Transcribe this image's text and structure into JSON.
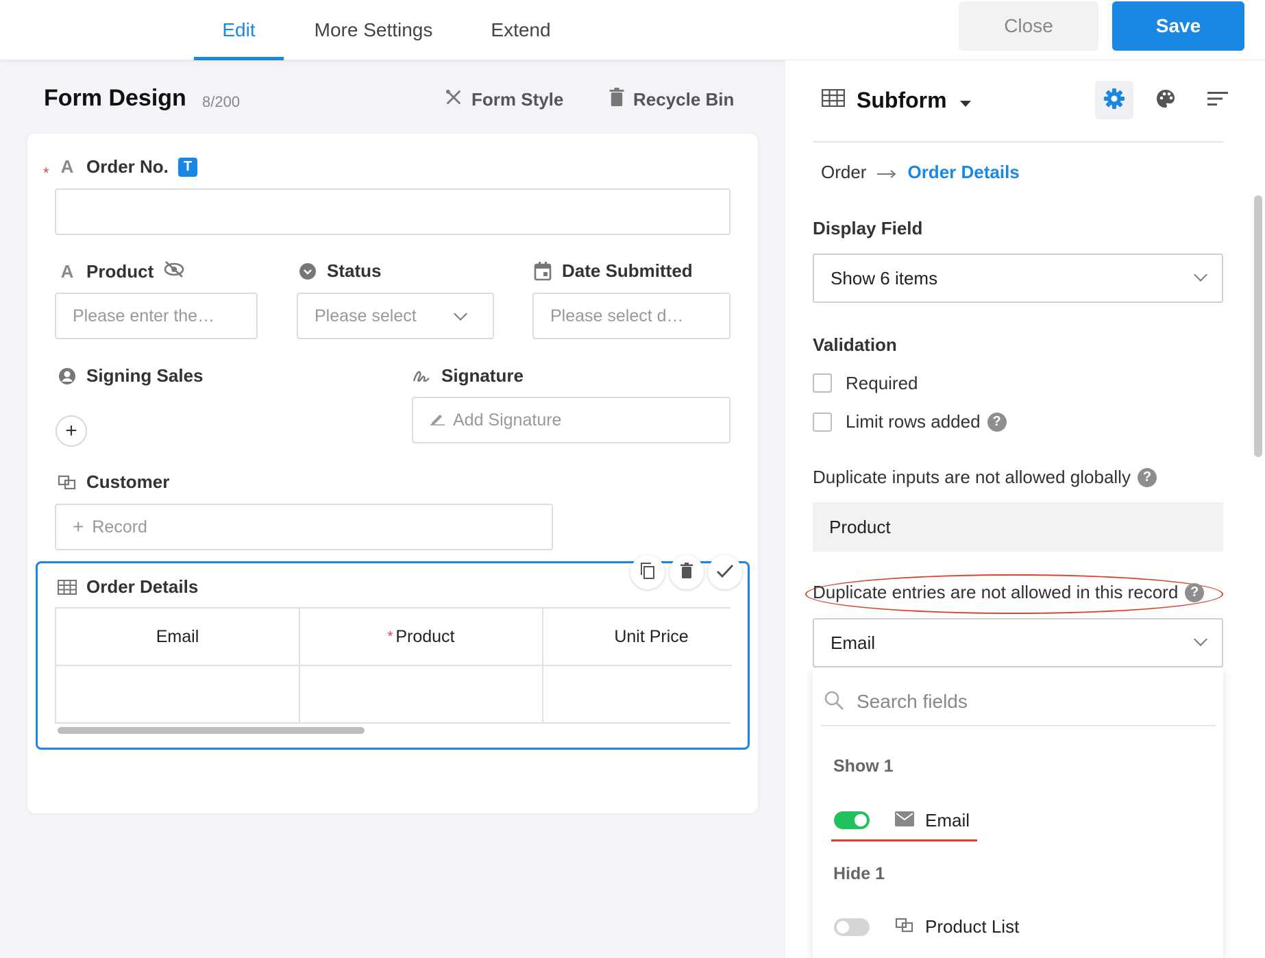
{
  "tabs": [
    {
      "label": "Edit",
      "active": true
    },
    {
      "label": "More Settings",
      "active": false
    },
    {
      "label": "Extend",
      "active": false
    }
  ],
  "actions": {
    "close": "Close",
    "save": "Save"
  },
  "form": {
    "title": "Form Design",
    "count": "8/200",
    "style_link": "Form Style",
    "recycle_link": "Recycle Bin"
  },
  "fields": {
    "order_no": {
      "label": "Order No.",
      "badge": "T"
    },
    "product": {
      "label": "Product",
      "placeholder": "Please enter the…"
    },
    "status": {
      "label": "Status",
      "placeholder": "Please select"
    },
    "date_submitted": {
      "label": "Date Submitted",
      "placeholder": "Please select d…"
    },
    "signing_sales": {
      "label": "Signing Sales"
    },
    "signature": {
      "label": "Signature",
      "button": "Add Signature"
    },
    "customer": {
      "label": "Customer",
      "button": "Record"
    },
    "order_details": {
      "label": "Order Details",
      "columns": [
        "Email",
        "Product",
        "Unit Price"
      ]
    }
  },
  "panel": {
    "title": "Subform",
    "relation": {
      "from": "Order",
      "to": "Order Details"
    },
    "display_field_label": "Display Field",
    "display_field_value": "Show 6 items",
    "validation_label": "Validation",
    "required_label": "Required",
    "limit_rows_label": "Limit rows added",
    "dup_global_label": "Duplicate inputs are not allowed globally",
    "dup_global_value": "Product",
    "dup_record_label": "Duplicate entries are not allowed in this record",
    "dup_record_value": "Email",
    "search_placeholder": "Search fields",
    "show_group": "Show 1",
    "show_item": "Email",
    "hide_group": "Hide 1",
    "hide_item": "Product List"
  },
  "colors": {
    "accent": "#1b87e5",
    "toggle_on": "#21c25e",
    "annotation": "#d8432c"
  }
}
